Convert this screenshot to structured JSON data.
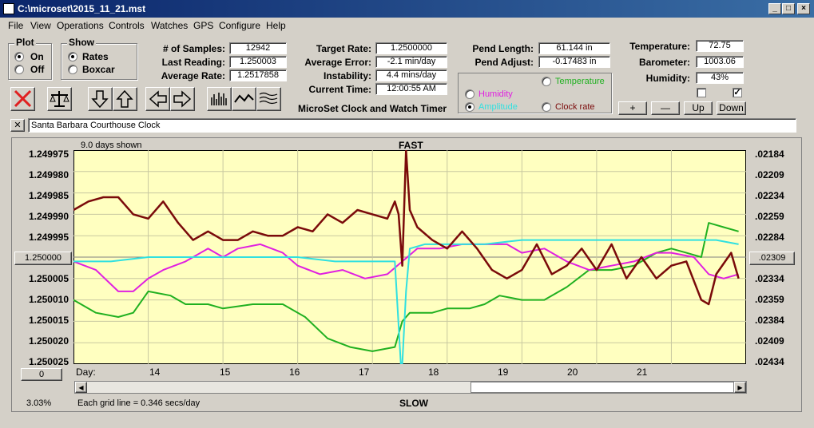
{
  "window": {
    "title": "C:\\microset\\2015_11_21.mst",
    "min": "_",
    "max": "□",
    "close": "×"
  },
  "menu": [
    "File",
    "View",
    "Operations",
    "Controls",
    "Watches",
    "GPS",
    "Configure",
    "Help"
  ],
  "plot": {
    "title": "Plot",
    "on": "On",
    "off": "Off",
    "selected": "On"
  },
  "show": {
    "title": "Show",
    "rates": "Rates",
    "boxcar": "Boxcar",
    "selected": "Rates"
  },
  "stats": {
    "samples_label": "# of Samples:",
    "samples": "12942",
    "last_label": "Last Reading:",
    "last": "1.250003",
    "avg_label": "Average Rate:",
    "avg": "1.2517858"
  },
  "rate": {
    "target_label": "Target Rate:",
    "target": "1.2500000",
    "avgerr_label": "Average Error:",
    "avgerr": "-2.1 min/day",
    "instab_label": "Instability:",
    "instab": "4.4 mins/day",
    "time_label": "Current Time:",
    "time": "12:00:55 AM",
    "caption": "MicroSet Clock and Watch Timer"
  },
  "pend": {
    "length_label": "Pend Length:",
    "length": "61.144 in",
    "adjust_label": "Pend Adjust:",
    "adjust": "-0.17483 in"
  },
  "series_opts": {
    "temperature": "Temperature",
    "humidity": "Humidity",
    "amplitude": "Amplitude",
    "clockrate": "Clock rate",
    "selected": "Amplitude"
  },
  "env": {
    "temp_label": "Temperature:",
    "temp": "72.75",
    "baro_label": "Barometer:",
    "baro": "1003.06",
    "hum_label": "Humidity:",
    "hum": "43%"
  },
  "zoom": {
    "plus": "+",
    "minus": "—",
    "up": "Up",
    "down": "Down"
  },
  "clock_name": "Santa Barbara Courthouse Clock",
  "close_x": "✕",
  "chart_top": {
    "shown": "9.0 days shown",
    "fast": "FAST"
  },
  "chart_bottom": {
    "pct": "3.03%",
    "grid": "Each grid line = 0.346 secs/day",
    "slow": "SLOW",
    "day": "Day:"
  },
  "left_btn": "1.250000",
  "left_zero": "0",
  "right_btn": ".02309",
  "colors": {
    "rate": "#7a0a0a",
    "humidity": "#e020e0",
    "amplitude": "#30e0e0",
    "temperature": "#20b020",
    "plot_bg": "#ffffc0"
  },
  "chart_data": {
    "type": "line",
    "xlabel": "Day:",
    "x_ticks": [
      "14",
      "15",
      "16",
      "17",
      "18",
      "19",
      "20",
      "21"
    ],
    "xlim": [
      13.0,
      22.0
    ],
    "y_left_ticks": [
      "1.249975",
      "1.249980",
      "1.249985",
      "1.249990",
      "1.249995",
      "1.250000",
      "1.250005",
      "1.250010",
      "1.250015",
      "1.250020",
      "1.250025"
    ],
    "ylim_left": [
      1.249975,
      1.250025
    ],
    "y_right_ticks": [
      ".02184",
      ".02209",
      ".02234",
      ".02259",
      ".02284",
      ".02309",
      ".02334",
      ".02359",
      ".02384",
      ".02409",
      ".02434"
    ],
    "ylim_right": [
      0.02184,
      0.02434
    ],
    "series": [
      {
        "name": "",
        "color": "#7a0a0a",
        "x": [
          13.0,
          13.2,
          13.4,
          13.6,
          13.8,
          14.0,
          14.2,
          14.4,
          14.6,
          14.8,
          15.0,
          15.2,
          15.4,
          15.6,
          15.8,
          16.0,
          16.2,
          16.4,
          16.6,
          16.8,
          17.0,
          17.2,
          17.3,
          17.35,
          17.4,
          17.45,
          17.5,
          17.6,
          17.8,
          18.0,
          18.2,
          18.4,
          18.6,
          18.8,
          19.0,
          19.2,
          19.4,
          19.6,
          19.8,
          20.0,
          20.2,
          20.4,
          20.6,
          20.8,
          21.0,
          21.2,
          21.4,
          21.5,
          21.6,
          21.8,
          21.9
        ],
        "y": [
          1.249989,
          1.249987,
          1.249986,
          1.249986,
          1.24999,
          1.249991,
          1.249987,
          1.249992,
          1.249996,
          1.249994,
          1.249996,
          1.249996,
          1.249994,
          1.249995,
          1.249995,
          1.249993,
          1.249994,
          1.24999,
          1.249992,
          1.249989,
          1.24999,
          1.249991,
          1.249987,
          1.24999,
          1.250002,
          1.249975,
          1.249989,
          1.249993,
          1.249996,
          1.249998,
          1.249994,
          1.249998,
          1.250003,
          1.250005,
          1.250003,
          1.249997,
          1.250004,
          1.250002,
          1.249998,
          1.250003,
          1.249997,
          1.250005,
          1.25,
          1.250005,
          1.250002,
          1.250001,
          1.25001,
          1.250011,
          1.250004,
          1.249999,
          1.250005
        ]
      },
      {
        "name": "Humidity",
        "color": "#e020e0",
        "x": [
          13.0,
          13.3,
          13.6,
          13.8,
          14.0,
          14.2,
          14.5,
          14.8,
          15.0,
          15.2,
          15.5,
          15.8,
          16.0,
          16.3,
          16.6,
          16.9,
          17.2,
          17.4,
          17.6,
          17.9,
          18.2,
          18.5,
          18.8,
          19.0,
          19.3,
          19.6,
          19.9,
          20.2,
          20.5,
          20.8,
          21.0,
          21.3,
          21.5,
          21.7,
          21.9
        ],
        "y": [
          1.250001,
          1.250003,
          1.250008,
          1.250008,
          1.250005,
          1.250003,
          1.250001,
          1.249998,
          1.25,
          1.249998,
          1.249997,
          1.249999,
          1.250002,
          1.250004,
          1.250003,
          1.250005,
          1.250004,
          1.250001,
          1.249998,
          1.249998,
          1.249997,
          1.249997,
          1.249997,
          1.249999,
          1.249998,
          1.250001,
          1.250003,
          1.250002,
          1.250001,
          1.249999,
          1.249999,
          1.25,
          1.250004,
          1.250005,
          1.250004
        ]
      },
      {
        "name": "Amplitude",
        "color": "#30e0e0",
        "x": [
          13.0,
          13.5,
          14.0,
          14.5,
          15.0,
          15.5,
          16.0,
          16.5,
          17.0,
          17.3,
          17.38,
          17.4,
          17.45,
          17.5,
          17.7,
          18.0,
          18.5,
          19.0,
          19.5,
          20.0,
          20.5,
          21.0,
          21.3,
          21.6,
          21.9
        ],
        "y": [
          1.250001,
          1.250001,
          1.25,
          1.25,
          1.25,
          1.25,
          1.25,
          1.250001,
          1.250001,
          1.250001,
          1.250025,
          1.250025,
          1.250008,
          1.249998,
          1.249997,
          1.249997,
          1.249997,
          1.249996,
          1.249996,
          1.249996,
          1.249996,
          1.249996,
          1.249996,
          1.249996,
          1.249997
        ]
      },
      {
        "name": "Temperature",
        "color": "#20b020",
        "x": [
          13.0,
          13.3,
          13.6,
          13.8,
          14.0,
          14.3,
          14.5,
          14.8,
          15.0,
          15.4,
          15.8,
          16.1,
          16.4,
          16.7,
          17.0,
          17.3,
          17.4,
          17.5,
          17.8,
          18.0,
          18.3,
          18.5,
          18.7,
          19.0,
          19.3,
          19.6,
          19.9,
          20.2,
          20.5,
          20.8,
          21.0,
          21.2,
          21.4,
          21.5,
          21.7,
          21.9
        ],
        "y": [
          1.25001,
          1.250013,
          1.250014,
          1.250013,
          1.250008,
          1.250009,
          1.250011,
          1.250011,
          1.250012,
          1.250011,
          1.250011,
          1.250014,
          1.250019,
          1.250021,
          1.250022,
          1.250021,
          1.250015,
          1.250013,
          1.250013,
          1.250012,
          1.250012,
          1.250011,
          1.250009,
          1.25001,
          1.25001,
          1.250007,
          1.250003,
          1.250003,
          1.250002,
          1.249999,
          1.249998,
          1.249999,
          1.25,
          1.249992,
          1.249993,
          1.249994
        ]
      }
    ]
  }
}
